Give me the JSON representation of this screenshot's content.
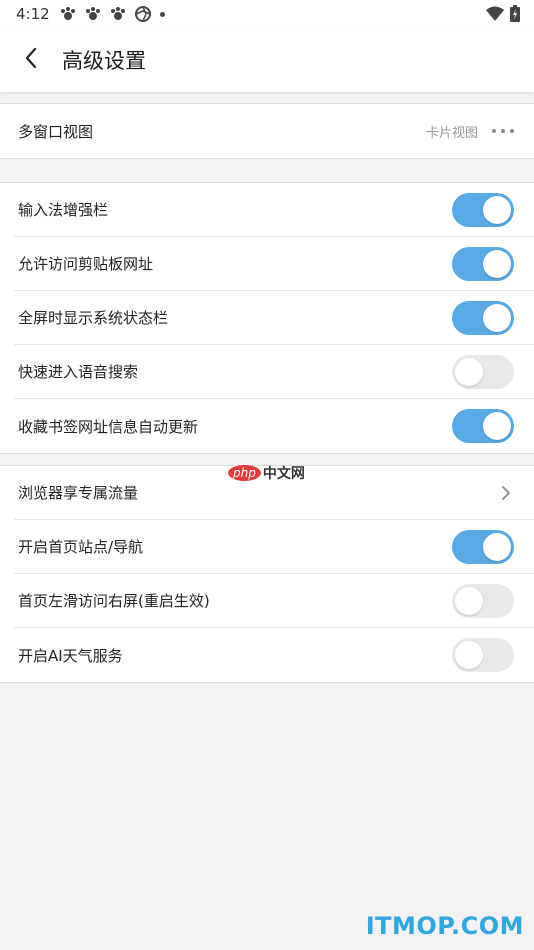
{
  "status_bar": {
    "time": "4:12",
    "icons": [
      "paw-icon",
      "paw-icon",
      "paw-icon",
      "aperture-icon",
      "dot-icon"
    ],
    "right_icons": [
      "wifi-icon",
      "battery-icon"
    ]
  },
  "header": {
    "back_icon": "chevron-left-icon",
    "title": "高级设置"
  },
  "group1": {
    "items": [
      {
        "label": "多窗口视图",
        "value": "卡片视图",
        "control": "more"
      }
    ]
  },
  "group2": {
    "items": [
      {
        "label": "输入法增强栏",
        "control": "toggle",
        "on": true
      },
      {
        "label": "允许访问剪贴板网址",
        "control": "toggle",
        "on": true
      },
      {
        "label": "全屏时显示系统状态栏",
        "control": "toggle",
        "on": true
      },
      {
        "label": "快速进入语音搜索",
        "control": "toggle",
        "on": false
      },
      {
        "label": "收藏书签网址信息自动更新",
        "control": "toggle",
        "on": true
      }
    ]
  },
  "group3": {
    "items": [
      {
        "label": "浏览器享专属流量",
        "control": "chevron"
      },
      {
        "label": "开启首页站点/导航",
        "control": "toggle",
        "on": true
      },
      {
        "label": "首页左滑访问右屏(重启生效)",
        "control": "toggle",
        "on": false
      },
      {
        "label": "开启AI天气服务",
        "control": "toggle",
        "on": false
      }
    ]
  },
  "watermarks": {
    "php_badge": "php",
    "php_text": "中文网",
    "itmop": "ITMOP.COM"
  },
  "colors": {
    "toggle_on": "#58a9e6",
    "toggle_off": "#e8e8e8",
    "watermark_itmop": "#2fa7e0"
  }
}
